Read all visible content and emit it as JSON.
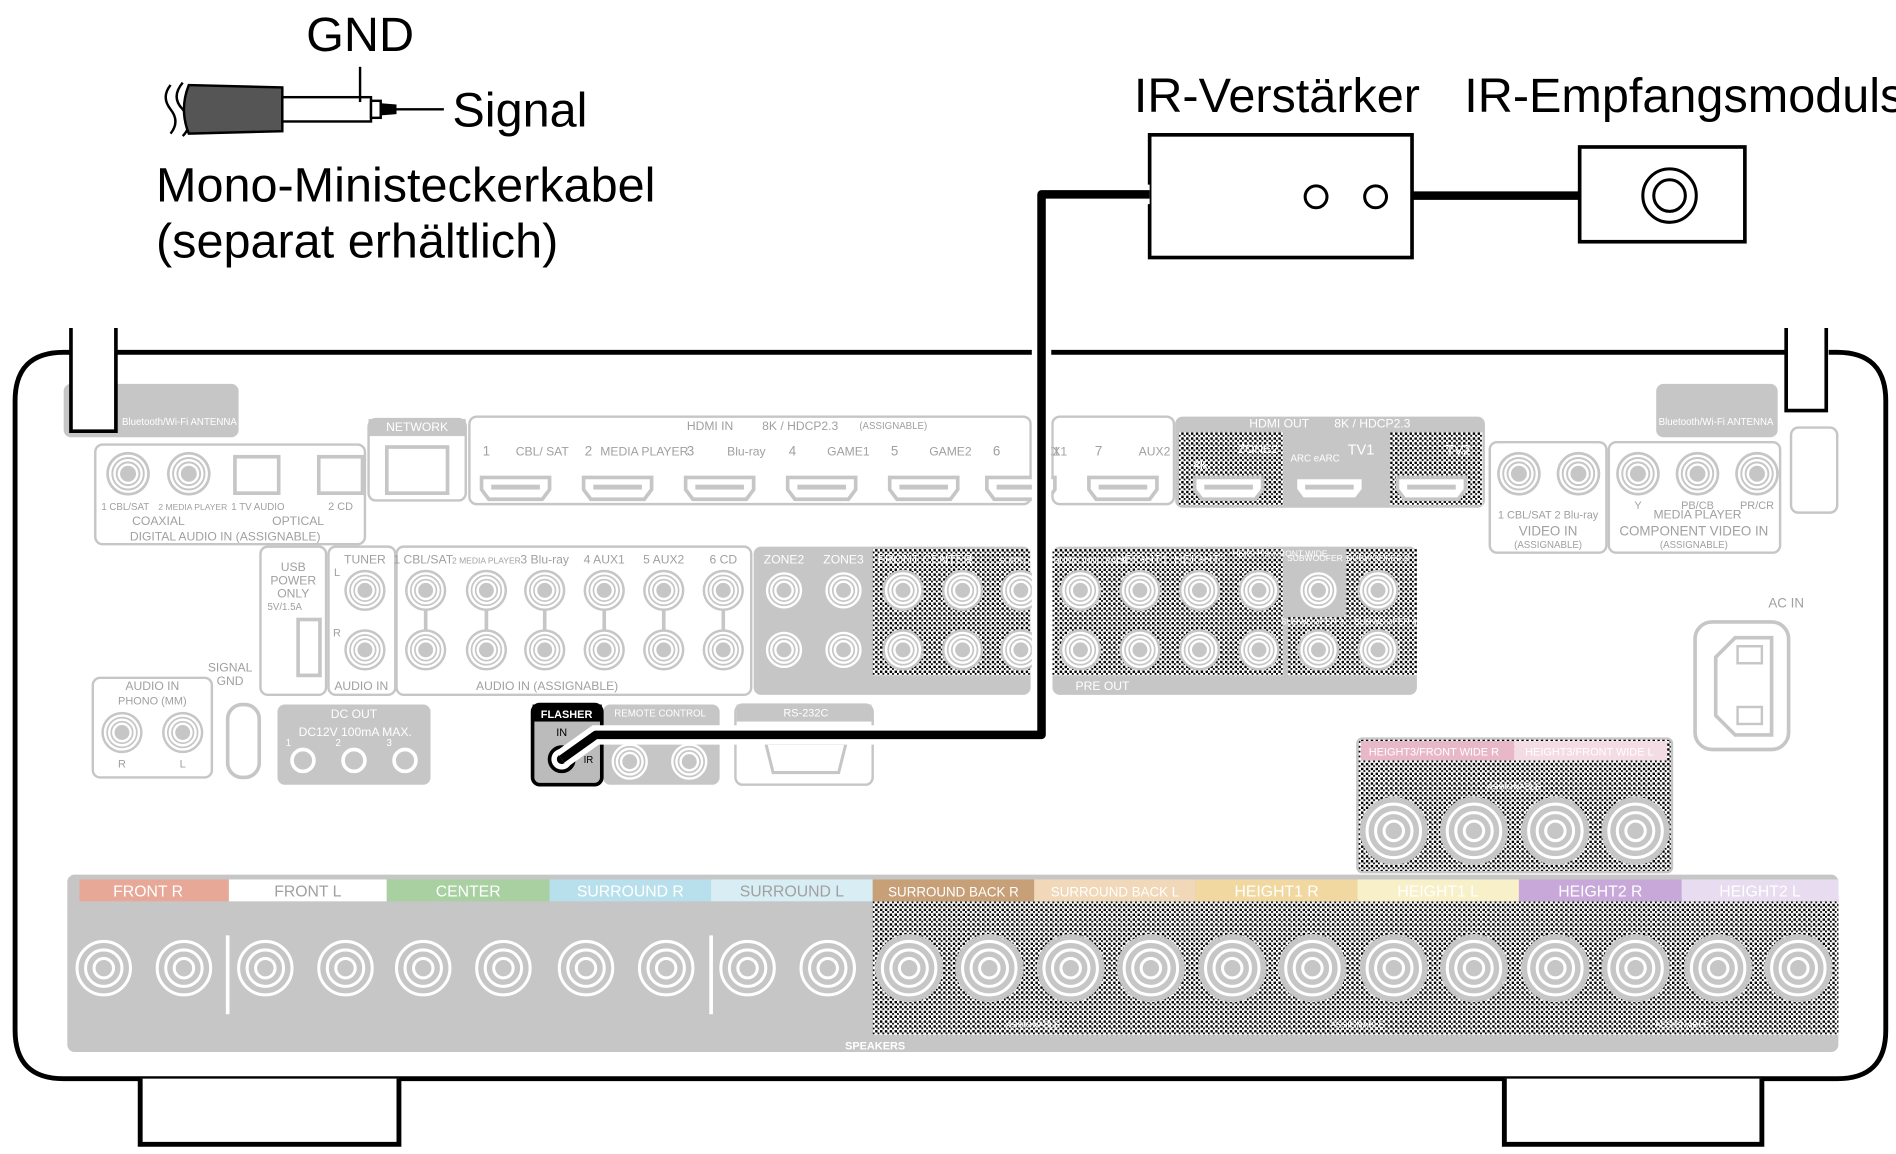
{
  "cable": {
    "gnd": "GND",
    "signal": "Signal",
    "name": "Mono-Ministeckerkabel",
    "note": "(separat erhältlich)"
  },
  "devices": {
    "ir_amp": "IR-Verstärker",
    "ir_receiver": "IR-Empfangsmoduls"
  },
  "colors": {
    "accent_cable": "#000000",
    "panel_gray": "#c6c6c6",
    "label_gray": "#a0a0a0",
    "front_r": "#e8a898",
    "center": "#a8d0a0",
    "surround_r": "#b8e0ec",
    "surround_l": "#d8eef4",
    "surround_back_r": "#c8a078",
    "surround_back_l": "#f0d8b8",
    "height1_r": "#f0d8a0",
    "height1_l": "#f8f0c8",
    "height2_r": "#c8a8d8",
    "height2_l": "#e8dcf0",
    "height3_r": "#e8b8c8",
    "height3_l": "#f4dce4"
  },
  "receiver": {
    "antenna": "Bluetooth/Wi-Fi ANTENNA",
    "network": "NETWORK",
    "hdmi_in": {
      "title": "HDMI IN",
      "spec": "8K / HDCP2.3",
      "assignable": "(ASSIGNABLE)",
      "ports": [
        {
          "num": "1",
          "label": "CBL/ SAT"
        },
        {
          "num": "2",
          "label": "MEDIA PLAYER"
        },
        {
          "num": "3",
          "label": "Blu-ray"
        },
        {
          "num": "4",
          "label": "GAME1"
        },
        {
          "num": "5",
          "label": "GAME2"
        },
        {
          "num": "6",
          "label": "X1"
        },
        {
          "num": "7",
          "label": "AUX2"
        }
      ]
    },
    "hdmi_out": {
      "title": "HDMI OUT",
      "spec": "8K / HDCP2.3",
      "zone2": "ZONE2",
      "k4": "4K",
      "arc": "ARC eARC",
      "tv1": "TV1",
      "tv2": "TV2"
    },
    "digital_audio": {
      "coax1": "1 CBL/SAT",
      "coax2": "2 MEDIA PLAYER",
      "opt1": "1 TV AUDIO",
      "opt2": "2 CD",
      "coaxial": "COAXIAL",
      "optical": "OPTICAL",
      "title": "DIGITAL AUDIO IN (ASSIGNABLE)"
    },
    "video_in": {
      "ports": "1 CBL/SAT 2 Blu-ray",
      "title": "VIDEO IN",
      "assignable": "(ASSIGNABLE)"
    },
    "component": {
      "y": "Y",
      "pb": "PB/CB",
      "pr": "PR/CR",
      "source": "MEDIA PLAYER",
      "title": "COMPONENT VIDEO IN",
      "assignable": "(ASSIGNABLE)"
    },
    "usb": {
      "line1": "USB",
      "line2": "POWER",
      "line3": "ONLY",
      "rating": "5V/1.5A"
    },
    "tuner": {
      "title": "TUNER",
      "l": "L",
      "r": "R",
      "audio_in": "AUDIO IN"
    },
    "audio_in": {
      "inputs": [
        "1 CBL/SAT",
        "2 MEDIA PLAYER",
        "3 Blu-ray",
        "4 AUX1",
        "5 AUX2",
        "6 CD"
      ],
      "title": "AUDIO IN (ASSIGNABLE)"
    },
    "zone": {
      "zone2": "ZONE2",
      "zone3": "ZONE3",
      "fc": "FRONT  CENTER",
      "sur": "SURROUND"
    },
    "pre_out": {
      "sb": "SURROUND BACK",
      "h1": "HEIGHT1",
      "h2": "HEIGHT2",
      "h3": "HEIGHT3/ FRONT WIDE",
      "sw1": "SUBWOOFER 1",
      "sw2": "SUBWOOFER 2",
      "sw3": "SUBWOOFER 3",
      "sw4": "SUBWOOFER 4",
      "title": "PRE  OUT"
    },
    "ac_in": "AC IN",
    "phono": {
      "title": "AUDIO IN",
      "sub": "PHONO (MM)",
      "r": "R",
      "l": "L"
    },
    "signal_gnd": {
      "line1": "SIGNAL",
      "line2": "GND"
    },
    "dc_out": {
      "title": "DC OUT",
      "spec": "DC12V 100mA MAX.",
      "p1": "1",
      "p2": "2",
      "p3": "3"
    },
    "flasher": {
      "title": "FLASHER",
      "in": "IN",
      "ir": "IR"
    },
    "remote": "REMOTE CONTROL",
    "rs232c": "RS-232C",
    "height3": {
      "r": "HEIGHT3/FRONT WIDE R",
      "l": "HEIGHT3/FRONT WIDE L",
      "assignable": "ASSIGNABLE"
    },
    "speakers": {
      "title": "SPEAKERS",
      "assignable": "ASSIGNABLE",
      "channels": [
        "FRONT R",
        "FRONT L",
        "CENTER",
        "SURROUND R",
        "SURROUND L",
        "SURROUND BACK R",
        "SURROUND BACK L",
        "HEIGHT1 R",
        "HEIGHT1 L",
        "HEIGHT2 R",
        "HEIGHT2 L"
      ]
    }
  }
}
